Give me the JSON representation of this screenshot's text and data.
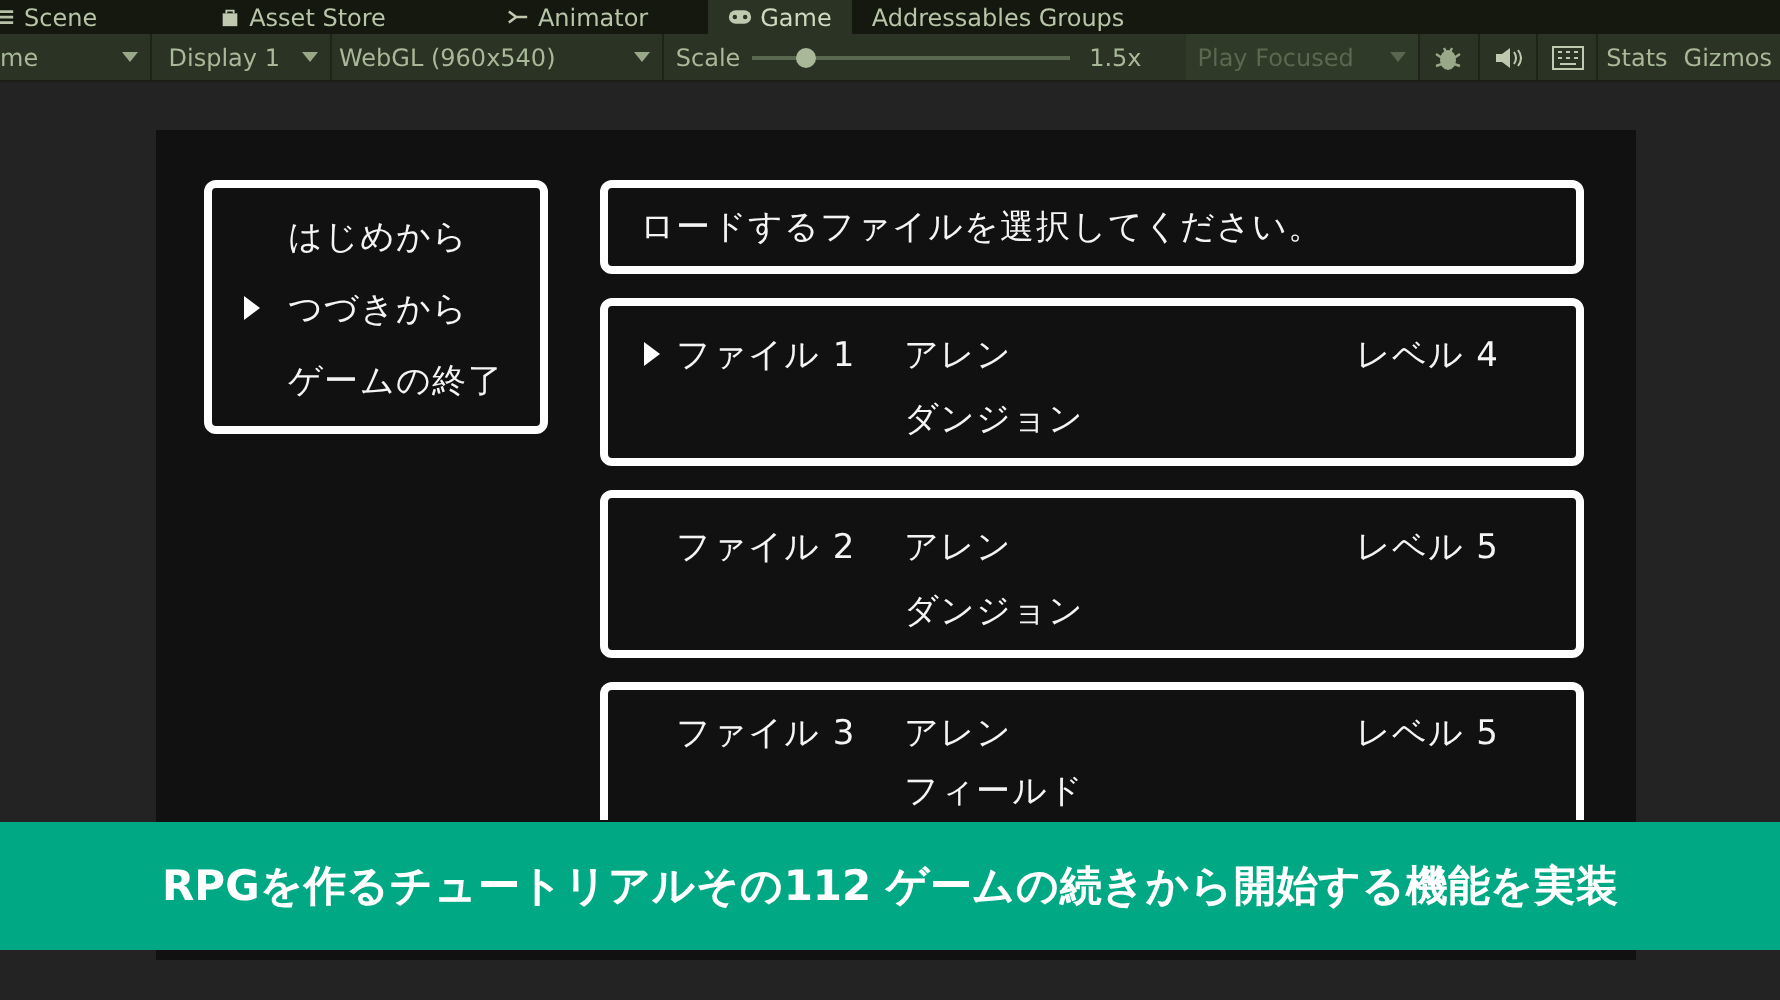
{
  "tabs": [
    {
      "label": "Scene",
      "selected": false
    },
    {
      "label": "Asset Store",
      "selected": false
    },
    {
      "label": "Animator",
      "selected": false
    },
    {
      "label": "Game",
      "selected": true
    },
    {
      "label": "Addressables Groups",
      "selected": false
    }
  ],
  "toolbar": {
    "view_dropdown": "me",
    "display_dropdown": "Display 1",
    "resolution_dropdown": "WebGL (960x540)",
    "scale_label": "Scale",
    "scale": {
      "level": 0.17
    },
    "scale_value": "1.5x",
    "play_mode": {
      "label": "Play Focused",
      "disabled": true
    },
    "stats": "Stats",
    "gizmos": "Gizmos"
  },
  "game": {
    "menu": [
      {
        "label": "はじめから",
        "selected": false
      },
      {
        "label": "つづきから",
        "selected": true
      },
      {
        "label": "ゲームの終了",
        "selected": false
      }
    ],
    "message": "ロードするファイルを選択してください。",
    "files": [
      {
        "file": "ファイル 1",
        "character": "アレン",
        "level": "レベル 4",
        "location": "ダンジョン",
        "selected": true
      },
      {
        "file": "ファイル 2",
        "character": "アレン",
        "level": "レベル 5",
        "location": "ダンジョン",
        "selected": false
      },
      {
        "file": "ファイル 3",
        "character": "アレン",
        "level": "レベル 5",
        "location": "フィールド",
        "selected": false
      }
    ]
  },
  "banner": "RPGを作るチュートリアルその112 ゲームの続きから開始する機能を実装"
}
